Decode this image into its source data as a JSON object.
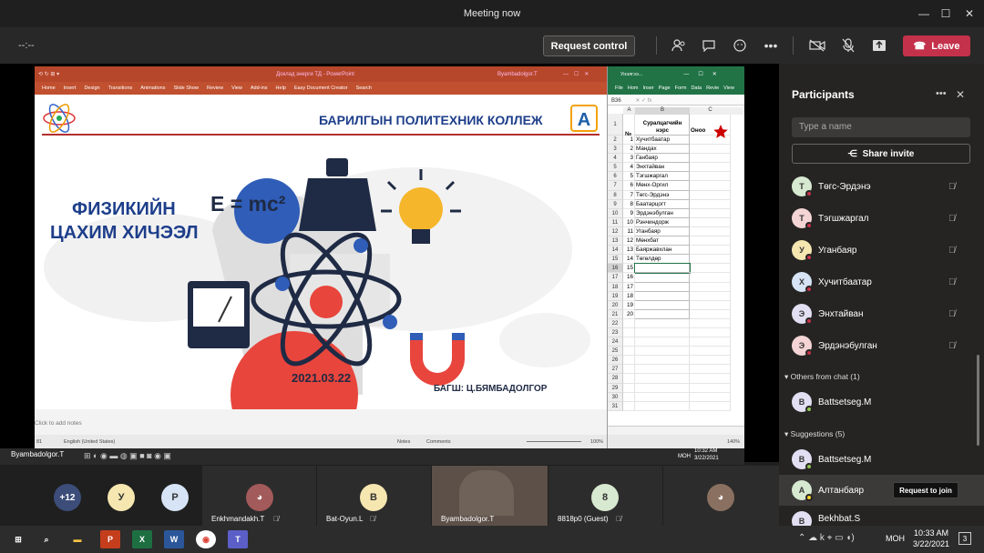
{
  "window": {
    "title": "Meeting now"
  },
  "toolbar": {
    "timer": "--:--",
    "request_control": "Request control",
    "leave": "Leave"
  },
  "ppt": {
    "title": "Доклад энерги ТД - PowerPoint",
    "user": "Byambadolgor.T",
    "tabs": [
      "Home",
      "Insert",
      "Design",
      "Transitions",
      "Animations",
      "Slide Show",
      "Review",
      "View",
      "Add-ins",
      "Help",
      "Easy Document Creator",
      "Search"
    ],
    "notes_placeholder": "Click to add notes",
    "status_lang": "English (United States)",
    "notes_btn": "Notes",
    "comments_btn": "Comments",
    "zoom": "100%",
    "slide_num": "81"
  },
  "slide": {
    "college": "БАРИЛГЫН ПОЛИТЕХНИК КОЛЛЕЖ",
    "heading1": "ФИЗИКИЙН",
    "heading2": "ЦАХИМ ХИЧЭЭЛ",
    "formula": "E = mc²",
    "date": "2021.03.22",
    "teacher": "БАГШ: Ц.БЯМБАДОЛГОР"
  },
  "excel": {
    "title": "Унэлгээ...",
    "tabs": [
      "File",
      "Hom",
      "Inser",
      "Page",
      "Form",
      "Data",
      "Revie",
      "View"
    ],
    "cellref": "B36",
    "colA": "A",
    "colB": "B",
    "colC": "C",
    "headerNo": "№",
    "headerName": "Суралцагчийн нэрс",
    "headerScore": "Оноо",
    "zoom": "140%",
    "rows": [
      {
        "r": "1",
        "n": "",
        "name": ""
      },
      {
        "r": "2",
        "n": "1",
        "name": "Хучитбаатар"
      },
      {
        "r": "3",
        "n": "2",
        "name": "Мандах"
      },
      {
        "r": "4",
        "n": "3",
        "name": "Ганбаяр"
      },
      {
        "r": "5",
        "n": "4",
        "name": "Энхтайван"
      },
      {
        "r": "6",
        "n": "5",
        "name": "Тэгшжаргал"
      },
      {
        "r": "7",
        "n": "6",
        "name": "Мөнх-Оргил"
      },
      {
        "r": "8",
        "n": "7",
        "name": "Төгс-Эрдэнэ"
      },
      {
        "r": "9",
        "n": "8",
        "name": "Баатарцогт"
      },
      {
        "r": "10",
        "n": "9",
        "name": "Эрдэнэбулган"
      },
      {
        "r": "11",
        "n": "10",
        "name": "Рэнчиндорж"
      },
      {
        "r": "12",
        "n": "11",
        "name": "Уганбаяр"
      },
      {
        "r": "13",
        "n": "12",
        "name": "Мөнхбат"
      },
      {
        "r": "14",
        "n": "13",
        "name": "Баяржавхлан"
      },
      {
        "r": "15",
        "n": "14",
        "name": "Төгөлдөр"
      },
      {
        "r": "16",
        "n": "15",
        "name": ""
      },
      {
        "r": "17",
        "n": "16",
        "name": ""
      },
      {
        "r": "18",
        "n": "17",
        "name": ""
      },
      {
        "r": "19",
        "n": "18",
        "name": ""
      },
      {
        "r": "20",
        "n": "19",
        "name": ""
      },
      {
        "r": "21",
        "n": "20",
        "name": ""
      },
      {
        "r": "22",
        "n": "",
        "name": ""
      },
      {
        "r": "23",
        "n": "",
        "name": ""
      },
      {
        "r": "24",
        "n": "",
        "name": ""
      },
      {
        "r": "25",
        "n": "",
        "name": ""
      },
      {
        "r": "26",
        "n": "",
        "name": ""
      },
      {
        "r": "27",
        "n": "",
        "name": ""
      },
      {
        "r": "28",
        "n": "",
        "name": ""
      },
      {
        "r": "29",
        "n": "",
        "name": ""
      },
      {
        "r": "30",
        "n": "",
        "name": ""
      },
      {
        "r": "31",
        "n": "",
        "name": ""
      }
    ]
  },
  "inner_taskbar": {
    "presenter": "Byambadolgor.T",
    "time": "10:32 AM",
    "date": "3/22/2021",
    "lang": "МОН"
  },
  "participants": {
    "title": "Participants",
    "search_placeholder": "Type a name",
    "share_invite": "Share invite",
    "list": [
      {
        "initial": "T",
        "name": "Төгс-Эрдэнэ"
      },
      {
        "initial": "T",
        "name": "Тэгшжаргал"
      },
      {
        "initial": "У",
        "name": "Уганбаяр"
      },
      {
        "initial": "Х",
        "name": "Хучитбаатар"
      },
      {
        "initial": "Э",
        "name": "Энхтайван"
      },
      {
        "initial": "Э",
        "name": "Эрдэнэбулган"
      }
    ],
    "others_label": "Others from chat (1)",
    "others": [
      {
        "initial": "B",
        "name": "Battsetseg.M"
      }
    ],
    "suggestions_label": "Suggestions (5)",
    "suggestions": [
      {
        "initial": "B",
        "name": "Battsetseg.M"
      },
      {
        "initial": "A",
        "name": "Алтанбаяр"
      },
      {
        "initial": "B",
        "name": "Bekhbat.S"
      }
    ],
    "request_join": "Request to join"
  },
  "strip": {
    "more": "+12",
    "avatar_u": "У",
    "avatar_p": "Р",
    "tile1_name": "Enkhmandakh.T",
    "tile2_initial": "B",
    "tile2_name": "Bat-Oyun.L",
    "tile3_name": "Byambadolgor.T",
    "tile4_initial": "8",
    "tile4_name": "8818p0 (Guest)"
  },
  "wintaskbar": {
    "time": "10:33 AM",
    "date": "3/22/2021",
    "lang": "МОН",
    "notif": "3"
  }
}
